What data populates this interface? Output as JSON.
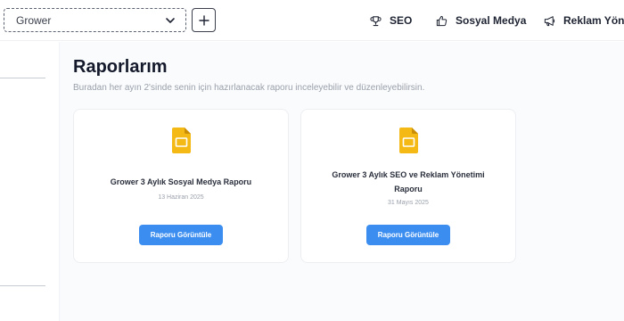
{
  "header": {
    "workspace_select": {
      "value": "Grower"
    },
    "nav": [
      {
        "label": "SEO",
        "icon": "trophy-icon"
      },
      {
        "label": "Sosyal Medya",
        "icon": "thumbs-up-icon"
      },
      {
        "label": "Reklam Yönet",
        "icon": "megaphone-icon"
      }
    ]
  },
  "main": {
    "title": "Raporlarım",
    "subtitle": "Buradan her ayın 2'sinde senin için hazırlanacak raporu inceleyebilir ve düzenleyebilirsin.",
    "reports": [
      {
        "title": "Grower 3 Aylık Sosyal Medya Raporu",
        "date": "13 Haziran 2025",
        "button_label": "Raporu Görüntüle"
      },
      {
        "title": "Grower 3 Aylık SEO ve Reklam Yönetimi Raporu",
        "date": "31 Mayıs 2025",
        "button_label": "Raporu Görüntüle"
      }
    ]
  },
  "colors": {
    "accent": "#3b8ef0",
    "doc_icon": "#f5b915",
    "title": "#141a2b",
    "muted": "#9aa0ab"
  }
}
